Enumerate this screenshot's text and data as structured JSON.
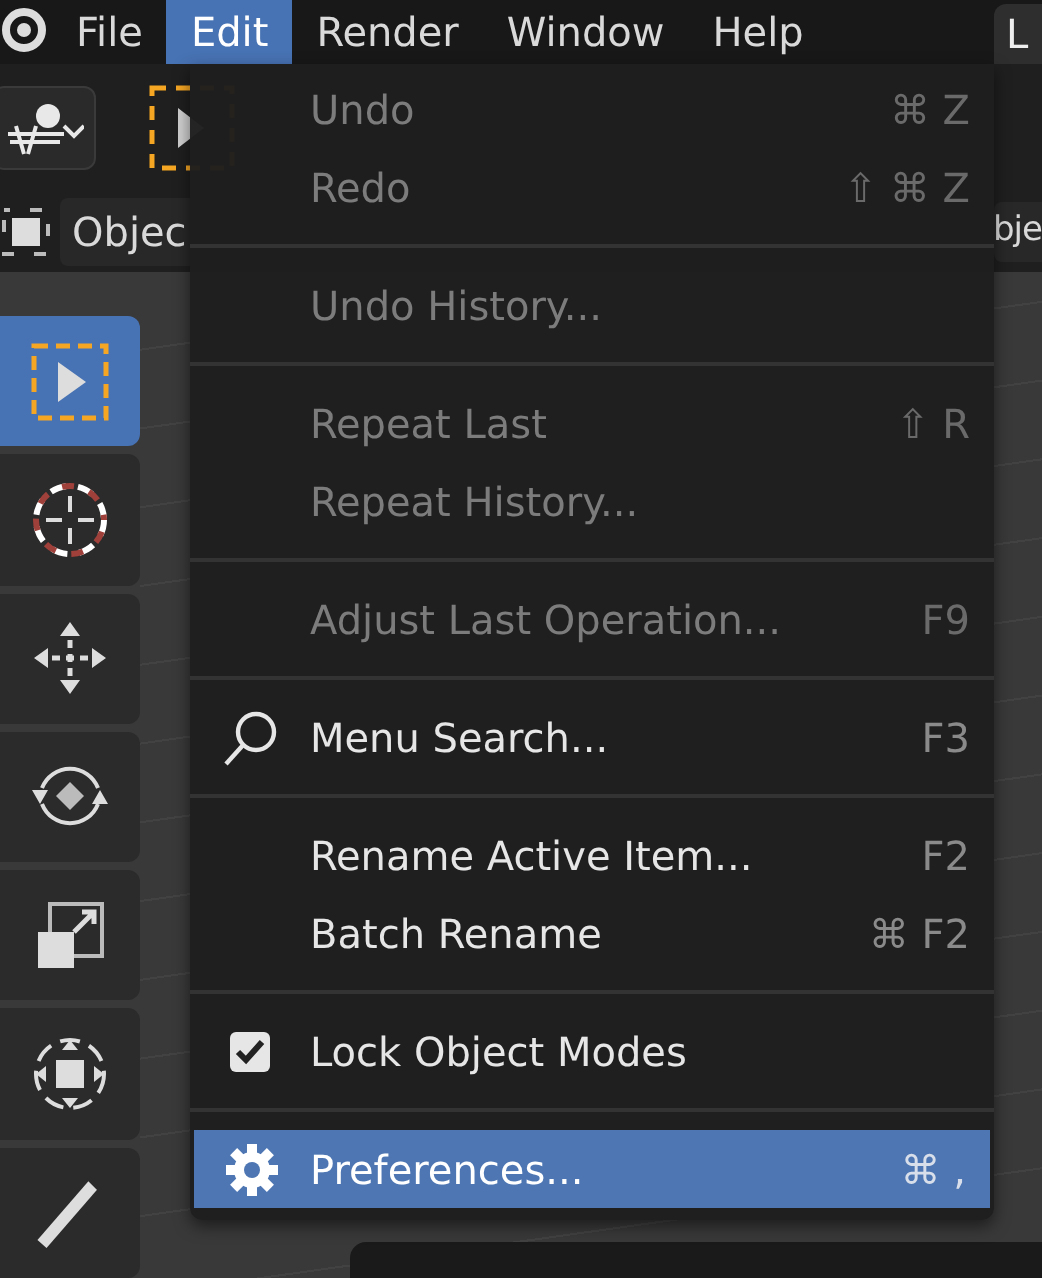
{
  "menubar": {
    "items": [
      {
        "label": "File",
        "selected": false
      },
      {
        "label": "Edit",
        "selected": true
      },
      {
        "label": "Render",
        "selected": false
      },
      {
        "label": "Window",
        "selected": false
      },
      {
        "label": "Help",
        "selected": false
      }
    ],
    "workspace_tab": "L"
  },
  "header": {
    "mode": "Objec",
    "menus": [
      "bje"
    ]
  },
  "toolbar": [
    {
      "kind": "select",
      "selected": true
    },
    {
      "kind": "cursor",
      "selected": false
    },
    {
      "kind": "move",
      "selected": false
    },
    {
      "kind": "rotate",
      "selected": false
    },
    {
      "kind": "scale",
      "selected": false
    },
    {
      "kind": "transform",
      "selected": false
    },
    {
      "kind": "annotate",
      "selected": false
    }
  ],
  "edit_menu": [
    {
      "kind": "command",
      "label": "Undo",
      "shortcut": "⌘ Z",
      "disabled": true,
      "selected": false
    },
    {
      "kind": "command",
      "label": "Redo",
      "shortcut": "⇧ ⌘ Z",
      "disabled": true,
      "selected": false
    },
    {
      "kind": "separator"
    },
    {
      "kind": "command",
      "label": "Undo History...",
      "disabled": true,
      "selected": false
    },
    {
      "kind": "separator"
    },
    {
      "kind": "command",
      "label": "Repeat Last",
      "shortcut": "⇧ R",
      "disabled": true,
      "selected": false
    },
    {
      "kind": "command",
      "label": "Repeat History...",
      "disabled": true,
      "selected": false
    },
    {
      "kind": "separator"
    },
    {
      "kind": "command",
      "label": "Adjust Last Operation...",
      "shortcut": "F9",
      "disabled": true,
      "selected": false
    },
    {
      "kind": "separator"
    },
    {
      "kind": "search",
      "label": "Menu Search...",
      "shortcut": "F3",
      "disabled": false,
      "selected": false
    },
    {
      "kind": "separator"
    },
    {
      "kind": "command",
      "label": "Rename Active Item...",
      "shortcut": "F2",
      "disabled": false,
      "selected": false
    },
    {
      "kind": "command",
      "label": "Batch Rename",
      "shortcut": "⌘ F2",
      "disabled": false,
      "selected": false
    },
    {
      "kind": "separator"
    },
    {
      "kind": "toggle",
      "label": "Lock Object Modes",
      "checked": true,
      "disabled": false,
      "selected": false
    },
    {
      "kind": "separator"
    },
    {
      "kind": "settings",
      "label": "Preferences...",
      "shortcut": "⌘ ,",
      "disabled": false,
      "selected": true
    }
  ]
}
